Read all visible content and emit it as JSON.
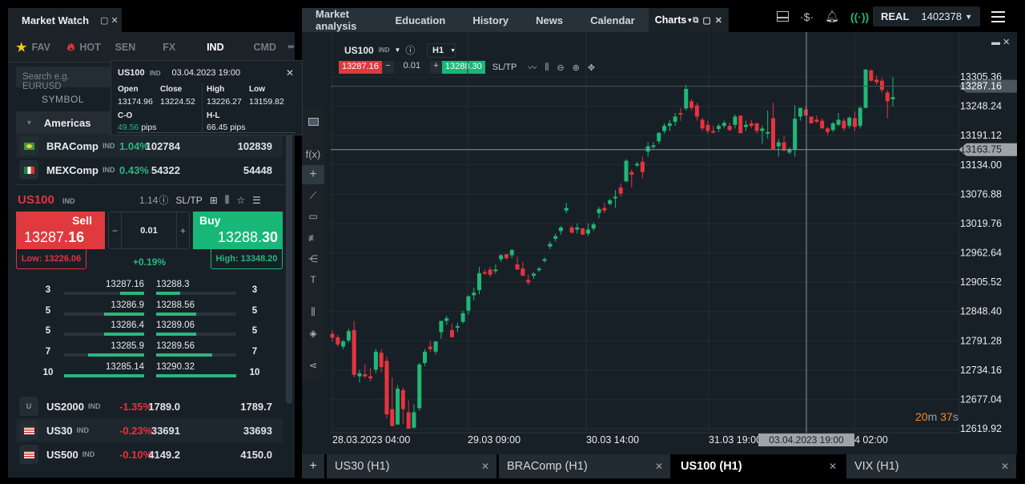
{
  "market_watch": {
    "title": "Market Watch",
    "tabs": [
      {
        "label": "FAV",
        "icon": "star-icon"
      },
      {
        "label": "HOT",
        "icon": "fire-icon"
      },
      {
        "label": "SEN"
      },
      {
        "label": "FX"
      },
      {
        "label": "IND",
        "active": true
      },
      {
        "label": "CMD"
      }
    ],
    "search_placeholder": "Search e.g. EURUSD",
    "column_symbol": "SYMBOL",
    "group": "Americas",
    "rows_top": [
      {
        "symbol": "BRAComp",
        "tag": "IND",
        "change": "1.04%",
        "bid": "102784",
        "ask": "102839",
        "dir": "up",
        "flag": "brazil-flag-icon"
      },
      {
        "symbol": "MEXComp",
        "tag": "IND",
        "change": "0.43%",
        "bid": "54322",
        "ask": "54448",
        "dir": "up",
        "flag": "mexico-flag-icon"
      }
    ],
    "rows_bottom": [
      {
        "symbol": "US2000",
        "tag": "IND",
        "change": "-1.35%",
        "bid": "1789.0",
        "ask": "1789.7",
        "dir": "dn",
        "flag": "U"
      },
      {
        "symbol": "US30",
        "tag": "IND",
        "change": "-0.23%",
        "bid": "33691",
        "ask": "33693",
        "dir": "dn",
        "flag": "us-flag-icon"
      },
      {
        "symbol": "US500",
        "tag": "IND",
        "change": "-0.10%",
        "bid": "4149.2",
        "ask": "4150.0",
        "dir": "dn",
        "flag": "us-flag-icon"
      }
    ]
  },
  "instrument": {
    "symbol": "US100",
    "tag": "IND",
    "spread": "1.14",
    "sltp": "SL/TP",
    "sell_label": "Sell",
    "sell_price_main": "13287.",
    "sell_price_pips": "16",
    "buy_label": "Buy",
    "buy_price_main": "13288.",
    "buy_price_pips": "30",
    "quantity": "0.01",
    "low": "Low: 13226.06",
    "high": "High: 13348.20",
    "change": "+0.19%"
  },
  "depth": [
    {
      "bid_qty": "3",
      "bid": "13287.16",
      "ask": "13288.3",
      "ask_qty": "3",
      "bid_fill": 0.3,
      "ask_fill": 0.3
    },
    {
      "bid_qty": "5",
      "bid": "13286.9",
      "ask": "13288.56",
      "ask_qty": "5",
      "bid_fill": 0.5,
      "ask_fill": 0.5
    },
    {
      "bid_qty": "5",
      "bid": "13286.4",
      "ask": "13289.06",
      "ask_qty": "5",
      "bid_fill": 0.5,
      "ask_fill": 0.5
    },
    {
      "bid_qty": "7",
      "bid": "13285.9",
      "ask": "13289.56",
      "ask_qty": "7",
      "bid_fill": 0.7,
      "ask_fill": 0.7
    },
    {
      "bid_qty": "10",
      "bid": "13285.14",
      "ask": "13290.32",
      "ask_qty": "10",
      "bid_fill": 1.0,
      "ask_fill": 1.0
    }
  ],
  "popup": {
    "symbol": "US100",
    "tag": "IND",
    "datetime": "03.04.2023 19:00",
    "open_label": "Open",
    "open": "13174.96",
    "close_label": "Close",
    "close": "13224.52",
    "high_label": "High",
    "high": "13226.27",
    "low_label": "Low",
    "low": "13159.82",
    "co_label": "C-O",
    "co_value": "49.56",
    "co_unit": "pips",
    "hl_label": "H-L",
    "hl_value": "66.45 pips"
  },
  "nav": {
    "items": [
      "Market analysis",
      "Education",
      "History",
      "News",
      "Calendar"
    ],
    "active": "Charts"
  },
  "account": {
    "type": "REAL",
    "number": "1402378"
  },
  "chart": {
    "symbol": "US100",
    "tag": "IND",
    "timeframe": "H1",
    "sell_price": "13287.16",
    "quantity": "0.01",
    "buy_price": "13288.30",
    "sltp": "SL/TP",
    "timer_min": "20",
    "timer_min_unit": "m",
    "timer_sec": "37",
    "timer_sec_unit": "s",
    "tabs": [
      {
        "label": "US30 (H1)"
      },
      {
        "label": "BRAComp (H1)"
      },
      {
        "label": "US100 (H1)",
        "active": true
      },
      {
        "label": "VIX (H1)"
      }
    ]
  },
  "chart_data": {
    "type": "candlestick",
    "title": "US100 IND H1",
    "ylim": [
      12600,
      13330
    ],
    "y_ticks": [
      "13305.36",
      "13248.24",
      "13191.12",
      "13134.00",
      "13076.88",
      "13019.76",
      "12962.64",
      "12905.52",
      "12848.40",
      "12791.28",
      "12734.16",
      "12677.04",
      "12619.92"
    ],
    "y_tick_values": [
      13305.36,
      13248.24,
      13191.12,
      13134.0,
      13076.88,
      13019.76,
      12962.64,
      12905.52,
      12848.4,
      12791.28,
      12734.16,
      12677.04,
      12619.92
    ],
    "x_ticks": [
      "28.03.2023 04:00",
      "29.03 09:00",
      "30.03 14:00",
      "31.03 19:00",
      "4 02:00"
    ],
    "current_price_label": "13287.16",
    "current_price": 13287.16,
    "crosshair_price_label": "13163.75",
    "crosshair_price": 13163.75,
    "crosshair_time_label": "03.04.2023 19:00",
    "candles": [
      [
        12805,
        12812,
        12790,
        12797
      ],
      [
        12798,
        12803,
        12780,
        12784
      ],
      [
        12780,
        12793,
        12775,
        12790
      ],
      [
        12792,
        12815,
        12788,
        12810
      ],
      [
        12812,
        12830,
        12720,
        12725
      ],
      [
        12722,
        12735,
        12710,
        12728
      ],
      [
        12726,
        12745,
        12718,
        12722
      ],
      [
        12722,
        12738,
        12712,
        12718
      ],
      [
        12735,
        12775,
        12728,
        12770
      ],
      [
        12768,
        12775,
        12730,
        12740
      ],
      [
        12752,
        12760,
        12640,
        12648
      ],
      [
        12658,
        12720,
        12625,
        12625
      ],
      [
        12628,
        12705,
        12628,
        12698
      ],
      [
        12695,
        12700,
        12630,
        12658
      ],
      [
        12652,
        12675,
        12620,
        12620
      ],
      [
        12622,
        12668,
        12620,
        12652
      ],
      [
        12660,
        12748,
        12655,
        12745
      ],
      [
        12748,
        12775,
        12742,
        12770
      ],
      [
        12780,
        12790,
        12770,
        12775
      ],
      [
        12770,
        12790,
        12765,
        12790
      ],
      [
        12808,
        12825,
        12795,
        12830
      ],
      [
        12830,
        12840,
        12822,
        12835
      ],
      [
        12812,
        12824,
        12805,
        12798
      ],
      [
        12818,
        12826,
        12808,
        12820
      ],
      [
        12828,
        12850,
        12825,
        12845
      ],
      [
        12850,
        12880,
        12842,
        12878
      ],
      [
        12880,
        12895,
        12870,
        12885
      ],
      [
        12890,
        12935,
        12882,
        12923
      ],
      [
        12925,
        12930,
        12920,
        12922
      ],
      [
        12930,
        12935,
        12915,
        12920
      ],
      [
        12928,
        12940,
        12922,
        12930
      ],
      [
        12950,
        12960,
        12945,
        12958
      ],
      [
        12960,
        12955,
        12950,
        12952
      ],
      [
        12958,
        12970,
        12952,
        12968
      ],
      [
        12940,
        12955,
        12935,
        12930
      ],
      [
        12932,
        12945,
        12925,
        12918
      ],
      [
        12910,
        12920,
        12900,
        12905
      ],
      [
        12918,
        12925,
        12912,
        12922
      ],
      [
        12930,
        12935,
        12925,
        12932
      ],
      [
        12948,
        12954,
        12944,
        12950
      ],
      [
        12975,
        12985,
        12970,
        12980
      ],
      [
        12990,
        13000,
        12985,
        12995
      ],
      [
        13005,
        13015,
        12998,
        13012
      ],
      [
        13045,
        13060,
        13040,
        13050
      ],
      [
        13012,
        13016,
        13000,
        13002
      ],
      [
        13008,
        13020,
        13000,
        13012
      ],
      [
        13010,
        13012,
        12998,
        12998
      ],
      [
        13000,
        13020,
        12995,
        13008
      ],
      [
        13010,
        13022,
        13005,
        13018
      ],
      [
        13040,
        13052,
        13030,
        13048
      ],
      [
        13050,
        13060,
        13040,
        13045
      ],
      [
        13058,
        13068,
        13055,
        13065
      ],
      [
        13070,
        13085,
        13050,
        13072
      ],
      [
        13090,
        13098,
        13072,
        13078
      ],
      [
        13102,
        13145,
        13100,
        13142
      ],
      [
        13120,
        13125,
        13090,
        13115
      ],
      [
        13136,
        13140,
        13130,
        13136
      ],
      [
        13140,
        13150,
        13108,
        13120
      ],
      [
        13160,
        13178,
        13150,
        13170
      ],
      [
        13170,
        13178,
        13165,
        13172
      ],
      [
        13180,
        13198,
        13175,
        13196
      ],
      [
        13200,
        13215,
        13195,
        13210
      ],
      [
        13210,
        13222,
        13200,
        13215
      ],
      [
        13218,
        13235,
        13210,
        13228
      ],
      [
        13235,
        13245,
        13220,
        13232
      ],
      [
        13244,
        13290,
        13240,
        13282
      ],
      [
        13258,
        13262,
        13240,
        13245
      ],
      [
        13250,
        13255,
        13220,
        13228
      ],
      [
        13222,
        13226,
        13200,
        13205
      ],
      [
        13212,
        13220,
        13195,
        13200
      ],
      [
        13200,
        13210,
        13195,
        13198
      ],
      [
        13204,
        13214,
        13198,
        13210
      ],
      [
        13210,
        13220,
        13205,
        13216
      ],
      [
        13210,
        13216,
        13200,
        13202
      ],
      [
        13212,
        13232,
        13205,
        13228
      ],
      [
        13230,
        13228,
        13195,
        13196
      ],
      [
        13208,
        13220,
        13200,
        13212
      ],
      [
        13215,
        13222,
        13205,
        13210
      ],
      [
        13215,
        13215,
        13195,
        13200
      ],
      [
        13200,
        13210,
        13175,
        13205
      ],
      [
        13195,
        13240,
        13185,
        13198
      ],
      [
        13225,
        13255,
        13170,
        13165
      ],
      [
        13170,
        13185,
        13150,
        13178
      ],
      [
        13178,
        13190,
        13160,
        13162
      ],
      [
        13158,
        13168,
        13155,
        13165
      ],
      [
        13164,
        13250,
        13150,
        13224
      ],
      [
        13228,
        13240,
        13220,
        13245
      ],
      [
        13242,
        13248,
        13232,
        13230
      ],
      [
        13228,
        13226,
        13220,
        13215
      ],
      [
        13222,
        13230,
        13215,
        13218
      ],
      [
        13220,
        13225,
        13212,
        13205
      ],
      [
        13205,
        13208,
        13192,
        13198
      ],
      [
        13202,
        13218,
        13198,
        13215
      ],
      [
        13212,
        13235,
        13210,
        13222
      ],
      [
        13220,
        13225,
        13200,
        13205
      ],
      [
        13210,
        13228,
        13205,
        13226
      ],
      [
        13225,
        13238,
        13200,
        13208
      ],
      [
        13210,
        13248,
        13205,
        13245
      ],
      [
        13245,
        13318,
        13245,
        13320
      ],
      [
        13318,
        13320,
        13296,
        13298
      ],
      [
        13300,
        13308,
        13290,
        13295
      ],
      [
        13298,
        13303,
        13275,
        13280
      ],
      [
        13275,
        13280,
        13225,
        13258
      ],
      [
        13262,
        13305,
        13248,
        13266
      ]
    ]
  }
}
